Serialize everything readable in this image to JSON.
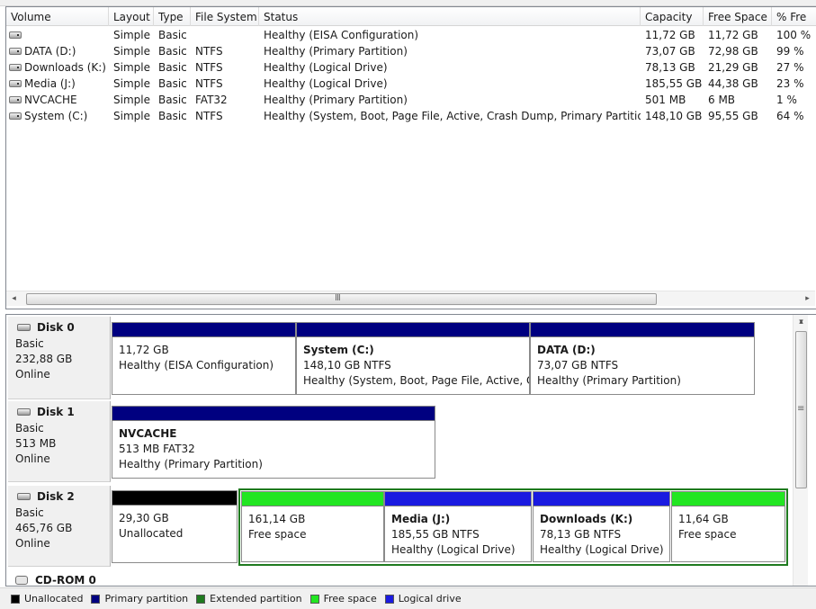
{
  "volume_list": {
    "columns": [
      "Volume",
      "Layout",
      "Type",
      "File System",
      "Status",
      "Capacity",
      "Free Space",
      "% Fre"
    ],
    "rows": [
      [
        "",
        "Simple",
        "Basic",
        "",
        "Healthy (EISA Configuration)",
        "11,72 GB",
        "11,72 GB",
        "100 %"
      ],
      [
        "DATA (D:)",
        "Simple",
        "Basic",
        "NTFS",
        "Healthy (Primary Partition)",
        "73,07 GB",
        "72,98 GB",
        "99 %"
      ],
      [
        "Downloads (K:)",
        "Simple",
        "Basic",
        "NTFS",
        "Healthy (Logical Drive)",
        "78,13 GB",
        "21,29 GB",
        "27 %"
      ],
      [
        "Media (J:)",
        "Simple",
        "Basic",
        "NTFS",
        "Healthy (Logical Drive)",
        "185,55 GB",
        "44,38 GB",
        "23 %"
      ],
      [
        "NVCACHE",
        "Simple",
        "Basic",
        "FAT32",
        "Healthy (Primary Partition)",
        "501 MB",
        "6 MB",
        "1 %"
      ],
      [
        "System (C:)",
        "Simple",
        "Basic",
        "NTFS",
        "Healthy (System, Boot, Page File, Active, Crash Dump, Primary Partition)",
        "148,10 GB",
        "95,55 GB",
        "64 %"
      ]
    ],
    "hscroll_grip": "III"
  },
  "disks": [
    {
      "name": "Disk 0",
      "type": "Basic",
      "size": "232,88 GB",
      "state": "Online",
      "partitions": [
        {
          "name": "",
          "size": "11,72 GB",
          "status": "Healthy (EISA Configuration)",
          "kind": "primary"
        },
        {
          "name": "System  (C:)",
          "size": "148,10 GB NTFS",
          "status": "Healthy (System, Boot, Page File, Active, Cr",
          "kind": "primary"
        },
        {
          "name": "DATA  (D:)",
          "size": "73,07 GB NTFS",
          "status": "Healthy (Primary Partition)",
          "kind": "primary"
        }
      ]
    },
    {
      "name": "Disk 1",
      "type": "Basic",
      "size": "513 MB",
      "state": "Online",
      "partitions": [
        {
          "name": "NVCACHE",
          "size": "513 MB FAT32",
          "status": "Healthy (Primary Partition)",
          "kind": "primary"
        }
      ]
    },
    {
      "name": "Disk 2",
      "type": "Basic",
      "size": "465,76 GB",
      "state": "Online",
      "partitions": [
        {
          "name": "",
          "size": "29,30 GB",
          "status": "Unallocated",
          "kind": "unallocated"
        },
        {
          "name": "",
          "size": "161,14 GB",
          "status": "Free space",
          "kind": "free"
        },
        {
          "name": "Media  (J:)",
          "size": "185,55 GB NTFS",
          "status": "Healthy (Logical Drive)",
          "kind": "logical"
        },
        {
          "name": "Downloads  (K:)",
          "size": "78,13 GB NTFS",
          "status": "Healthy (Logical Drive)",
          "kind": "logical"
        },
        {
          "name": "",
          "size": "11,64 GB",
          "status": "Free space",
          "kind": "free"
        }
      ]
    }
  ],
  "cdrom": {
    "name": "CD-ROM 0"
  },
  "legend": [
    {
      "label": "Unallocated",
      "color": "#000000"
    },
    {
      "label": "Primary partition",
      "color": "#000080"
    },
    {
      "label": "Extended partition",
      "color": "#1f7a1f"
    },
    {
      "label": "Free space",
      "color": "#22e622"
    },
    {
      "label": "Logical drive",
      "color": "#1a1ae0"
    }
  ],
  "bar_colors": {
    "primary": "#000080",
    "unallocated": "#000000",
    "free": "#22e622",
    "logical": "#1a1ae0",
    "extended_border": "#1f7a1f"
  }
}
